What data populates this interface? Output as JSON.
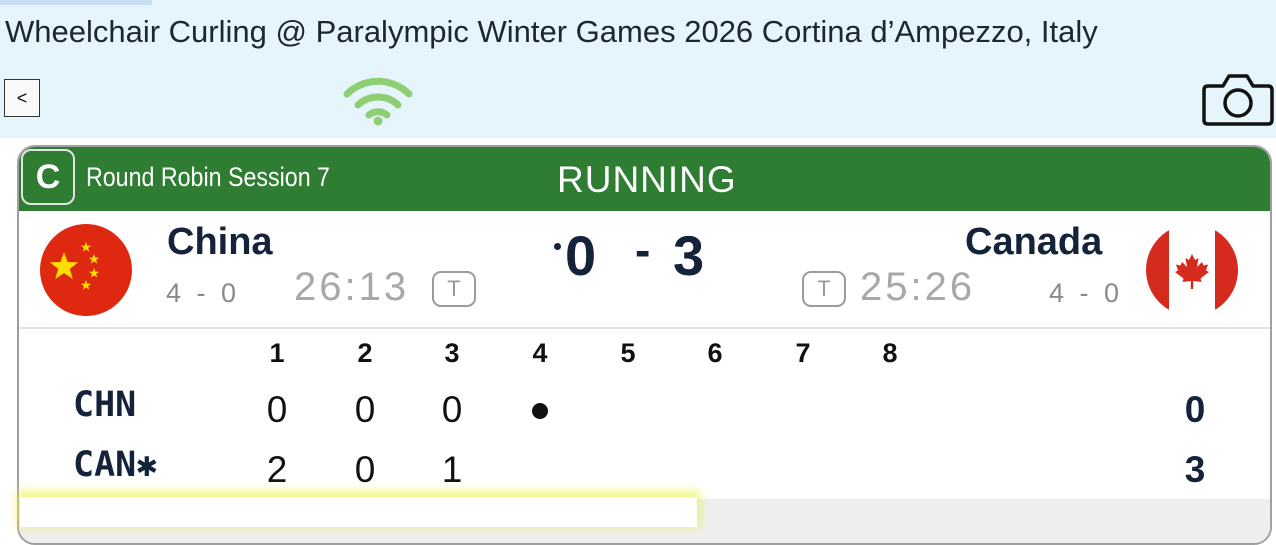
{
  "page_title": "Wheelchair Curling @ Paralympic Winter Games 2026 Cortina d’Ampezzo, Italy",
  "toolbar": {
    "back_label": "<",
    "icons": [
      "wifi-icon",
      "camera-icon"
    ],
    "wifi_color": "#8fcf73"
  },
  "game": {
    "badge": "C",
    "session": "Round Robin Session 7",
    "status": "RUNNING",
    "header_color": "#2e7d33",
    "team_left": {
      "name": "China",
      "abbr": "CHN",
      "record": "4 - 0",
      "time_left": "26:13",
      "timeout_label": "T",
      "score": "0",
      "flag": "china-flag"
    },
    "team_right": {
      "name": "Canada",
      "abbr": "CAN",
      "hammer_mark": "✱",
      "record": "4 - 0",
      "time_left": "25:26",
      "timeout_label": "T",
      "score": "3",
      "flag": "canada-flag"
    },
    "score_separator": "-"
  },
  "linescore": {
    "ends": [
      "1",
      "2",
      "3",
      "4",
      "5",
      "6",
      "7",
      "8"
    ],
    "rows": [
      {
        "team": "CHN",
        "ends": [
          "0",
          "0",
          "0",
          "",
          "",
          "",
          "",
          ""
        ],
        "current_end_marker": 4,
        "total": "0"
      },
      {
        "team": "CAN",
        "ends": [
          "2",
          "0",
          "1",
          "",
          "",
          "",
          "",
          ""
        ],
        "total": "3"
      }
    ]
  }
}
